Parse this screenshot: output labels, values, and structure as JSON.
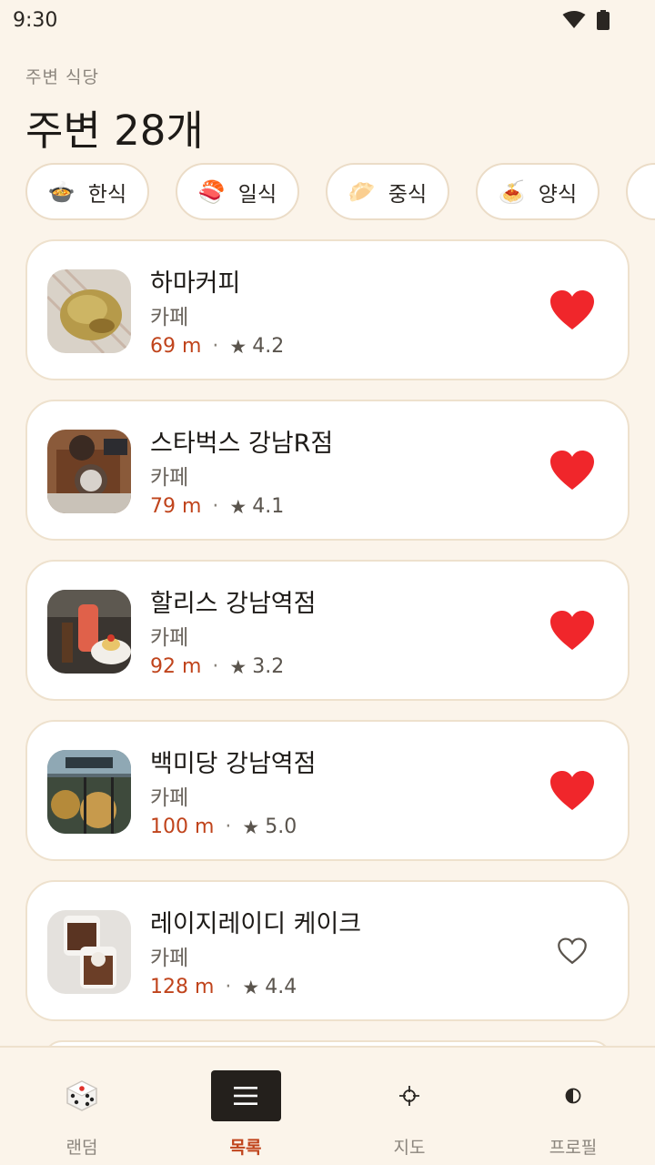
{
  "status": {
    "time": "9:30"
  },
  "header": {
    "subtitle": "주변 식당",
    "title": "주변 28개"
  },
  "chips": [
    {
      "emoji": "🍲",
      "label": "한식"
    },
    {
      "emoji": "🍣",
      "label": "일식"
    },
    {
      "emoji": "🥟",
      "label": "중식"
    },
    {
      "emoji": "🍝",
      "label": "양식"
    },
    {
      "emoji": "☕",
      "label": ""
    }
  ],
  "places": [
    {
      "name": "하마커피",
      "category": "카페",
      "distance": "69 m",
      "dot": "·",
      "star": "★",
      "rating": "4.2",
      "favorite": true
    },
    {
      "name": "스타벅스 강남R점",
      "category": "카페",
      "distance": "79 m",
      "dot": "·",
      "star": "★",
      "rating": "4.1",
      "favorite": true
    },
    {
      "name": "할리스 강남역점",
      "category": "카페",
      "distance": "92 m",
      "dot": "·",
      "star": "★",
      "rating": "3.2",
      "favorite": true
    },
    {
      "name": "백미당 강남역점",
      "category": "카페",
      "distance": "100 m",
      "dot": "·",
      "star": "★",
      "rating": "5.0",
      "favorite": true
    },
    {
      "name": "레이지레이디 케이크",
      "category": "카페",
      "distance": "128 m",
      "dot": "·",
      "star": "★",
      "rating": "4.4",
      "favorite": false
    }
  ],
  "nav": {
    "items": [
      {
        "label": "랜덤",
        "icon": "dice-icon",
        "active": false
      },
      {
        "label": "목록",
        "icon": "list-icon",
        "active": true
      },
      {
        "label": "지도",
        "icon": "crosshair-icon",
        "active": false
      },
      {
        "label": "프로필",
        "icon": "half-circle-icon",
        "active": false
      }
    ]
  },
  "colors": {
    "accent": "#c0441c",
    "background": "#fbf4ea",
    "heart": "#f0262b"
  }
}
